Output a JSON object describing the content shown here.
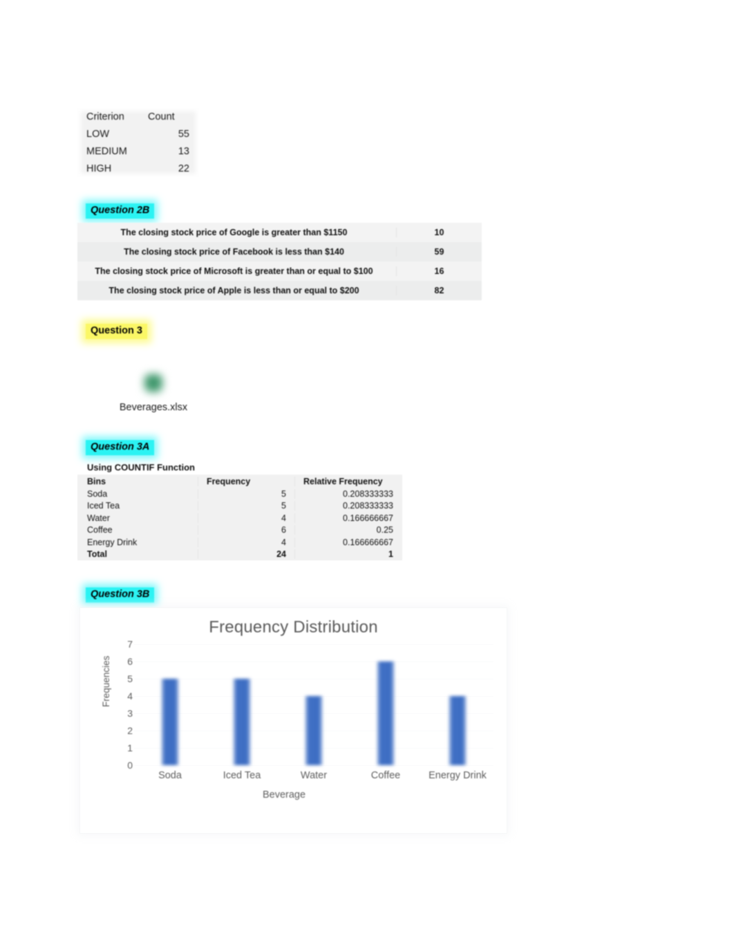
{
  "criterion_table": {
    "headers": [
      "Criterion",
      "Count"
    ],
    "rows": [
      {
        "criterion": "LOW",
        "count": "55"
      },
      {
        "criterion": "MEDIUM",
        "count": "13"
      },
      {
        "criterion": "HIGH",
        "count": "22"
      }
    ]
  },
  "sections": {
    "q2b": "Question 2B",
    "q3": "Question 3",
    "q3a": "Question 3A",
    "q3b": "Question 3B"
  },
  "statement_table": {
    "rows": [
      {
        "statement": "The closing stock price of Google is greater than $1150",
        "count": "10"
      },
      {
        "statement": "The closing stock price of Facebook is less than $140",
        "count": "59"
      },
      {
        "statement": "The closing stock price of Microsoft is greater than or equal to $100",
        "count": "16"
      },
      {
        "statement": "The closing stock price of Apple is less than or equal to $200",
        "count": "82"
      }
    ]
  },
  "attachment": {
    "icon": "excel-file-icon",
    "filename": "Beverages.xlsx"
  },
  "frequency_table": {
    "caption": "Using COUNTIF Function",
    "headers": [
      "Bins",
      "Frequency",
      "Relative Frequency"
    ],
    "rows": [
      {
        "bin": "Soda",
        "frequency": "5",
        "relative_frequency": "0.208333333"
      },
      {
        "bin": "Iced Tea",
        "frequency": "5",
        "relative_frequency": "0.208333333"
      },
      {
        "bin": "Water",
        "frequency": "4",
        "relative_frequency": "0.166666667"
      },
      {
        "bin": "Coffee",
        "frequency": "6",
        "relative_frequency": "0.25"
      },
      {
        "bin": "Energy Drink",
        "frequency": "4",
        "relative_frequency": "0.166666667"
      }
    ],
    "total": {
      "bin": "Total",
      "frequency": "24",
      "relative_frequency": "1"
    }
  },
  "chart_data": {
    "type": "bar",
    "title": "Frequency Distribution",
    "xlabel": "Beverage",
    "ylabel": "Frequencies",
    "categories": [
      "Soda",
      "Iced Tea",
      "Water",
      "Coffee",
      "Energy Drink"
    ],
    "values": [
      5,
      5,
      4,
      6,
      4
    ],
    "ylim": [
      0,
      7
    ],
    "yticks": [
      "7",
      "6",
      "5",
      "4",
      "3",
      "2",
      "1",
      "0"
    ],
    "grid": true,
    "legend": "none",
    "bar_color": "#4472C4"
  },
  "colors": {
    "highlight_cyan": "#2BF3F3",
    "highlight_yellow": "#FBF766",
    "chart_text": "#595959",
    "bar_blue": "#4472C4"
  }
}
